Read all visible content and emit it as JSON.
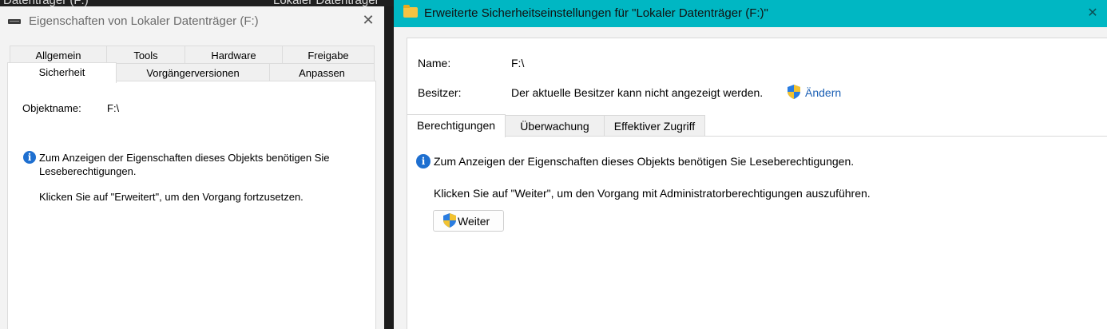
{
  "background_window": {
    "title_left": "Datenträger (F:)",
    "title_right": "Lokaler Datenträger"
  },
  "left_dialog": {
    "title": "Eigenschaften von Lokaler Datenträger (F:)",
    "close": "✕",
    "tabs_row1": [
      "Allgemein",
      "Tools",
      "Hardware",
      "Freigabe"
    ],
    "tabs_row2": [
      "Sicherheit",
      "Vorgängerversionen",
      "Anpassen"
    ],
    "active_tab": "Sicherheit",
    "object_label": "Objektname:",
    "object_value": "F:\\",
    "info_line1": "Zum Anzeigen der Eigenschaften dieses Objekts benötigen Sie",
    "info_line2": "Leseberechtigungen.",
    "hint": "Klicken Sie auf \"Erweitert\", um den Vorgang fortzusetzen."
  },
  "right_dialog": {
    "title": "Erweiterte Sicherheitseinstellungen für \"Lokaler Datenträger (F:)\"",
    "close": "✕",
    "accent_color": "#00b7c3",
    "name_label": "Name:",
    "name_value": "F:\\",
    "owner_label": "Besitzer:",
    "owner_value": "Der aktuelle Besitzer kann nicht angezeigt werden.",
    "change_link": "Ändern",
    "tabs": [
      "Berechtigungen",
      "Überwachung",
      "Effektiver Zugriff"
    ],
    "active_tab": "Berechtigungen",
    "info": "Zum Anzeigen der Eigenschaften dieses Objekts benötigen Sie Leseberechtigungen.",
    "hint": "Klicken Sie auf \"Weiter\", um den Vorgang mit Administratorberechtigungen auszuführen.",
    "continue_button": "Weiter"
  }
}
